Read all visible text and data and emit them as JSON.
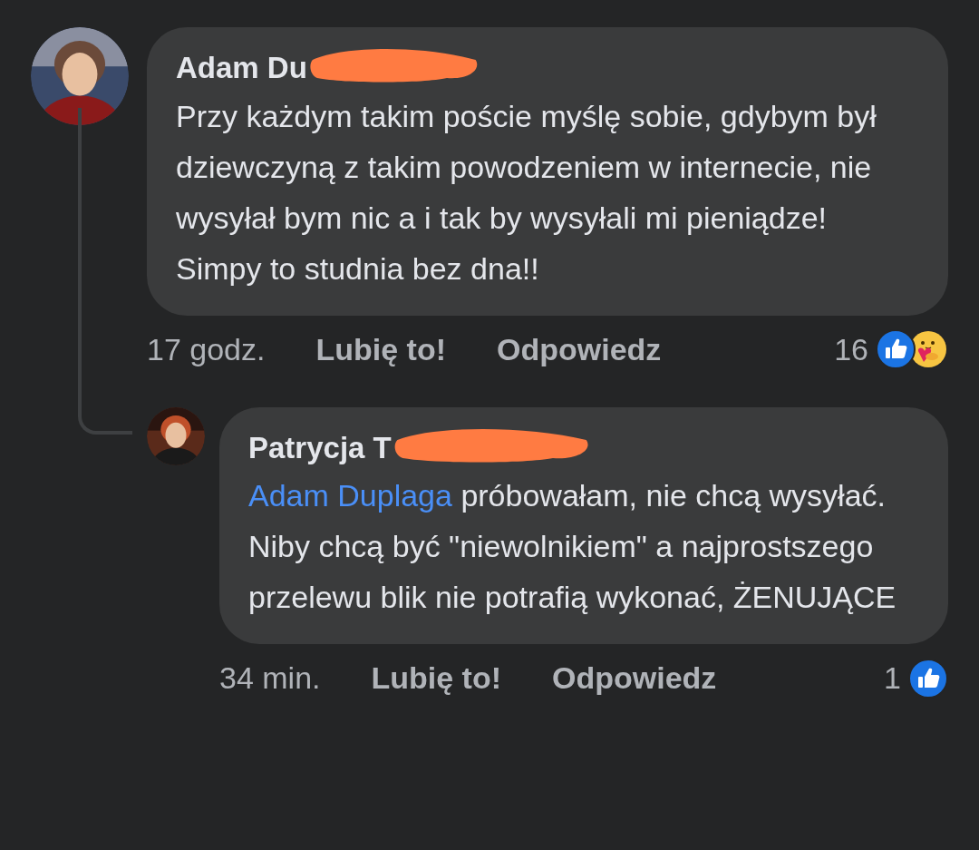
{
  "comments": [
    {
      "author": "Adam Du",
      "text": "Przy każdym takim poście myślę sobie, gdybym był dziewczyną z takim powodzeniem w internecie, nie wysyłał bym nic a i tak by wysyłali mi pieniądze! Simpy to studnia bez dna!!",
      "time": "17 godz.",
      "like": "Lubię to!",
      "reply": "Odpowiedz",
      "count": "16",
      "reactions": [
        {
          "kind": "like"
        },
        {
          "kind": "care"
        }
      ],
      "replies": [
        {
          "author": "Patrycja T",
          "mention": "Adam Duplaga",
          "text": "próbowałam, nie chcą wysyłać. Niby chcą być \"niewolnikiem\" a najprostszego przelewu blik nie potrafią wykonać, ŻENUJĄCE",
          "time": "34 min.",
          "like": "Lubię to!",
          "reply": "Odpowiedz",
          "count": "1",
          "reactions": [
            {
              "kind": "like"
            }
          ]
        }
      ]
    }
  ]
}
